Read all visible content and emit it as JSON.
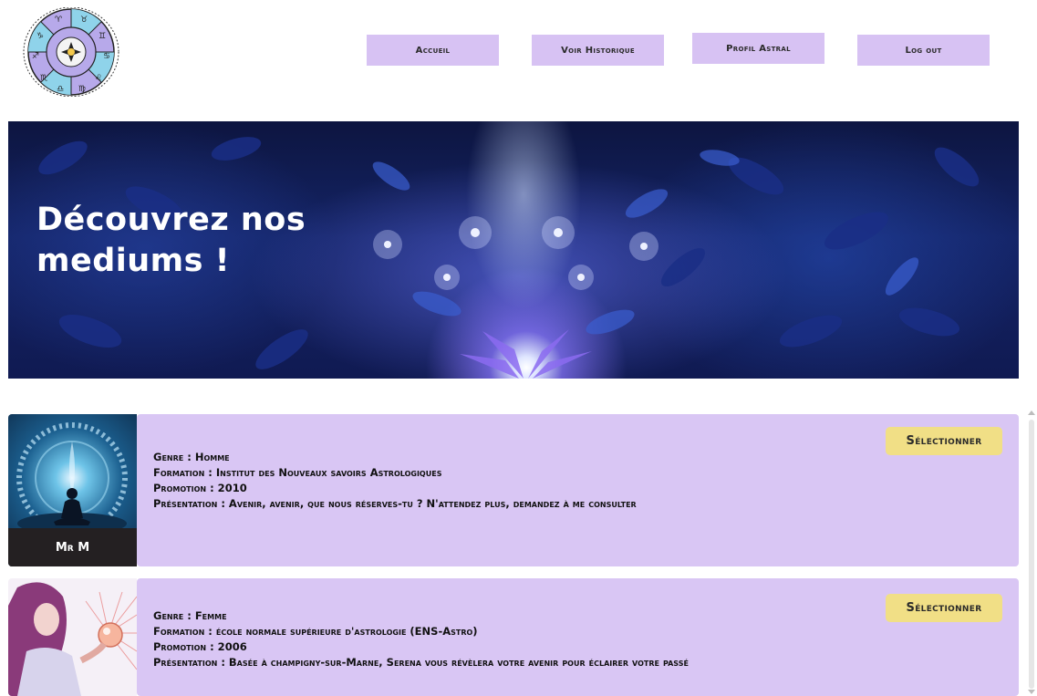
{
  "nav": {
    "accueil": "Accueil",
    "historique": "Voir Historique",
    "profil": "Profil Astral",
    "logout": "Log out"
  },
  "hero": {
    "title_line1": "Découvrez nos",
    "title_line2": "mediums !"
  },
  "mediums": [
    {
      "name": "Mr M",
      "genre": "Genre : Homme",
      "formation": "Formation : Institut des Nouveaux savoirs Astrologiques",
      "promotion": "Promotion : 2010",
      "presentation": "Présentation : Avenir, avenir, que nous réserves-tu ? N'attendez plus, demandez à me consulter",
      "select_label": "Sélectionner"
    },
    {
      "genre": "Genre : Femme",
      "formation": "Formation : école normale supérieure d'astrologie (ENS-Astro)",
      "promotion": "Promotion : 2006",
      "presentation": "Présentation : Basée à champigny-sur-Marne, Serena vous révèlera votre avenir pour éclairer votre passé",
      "select_label": "Sélectionner"
    }
  ],
  "colors": {
    "nav_bg": "#d7c2f3",
    "card_bg": "#d9c6f4",
    "select_bg": "#f1df86"
  }
}
